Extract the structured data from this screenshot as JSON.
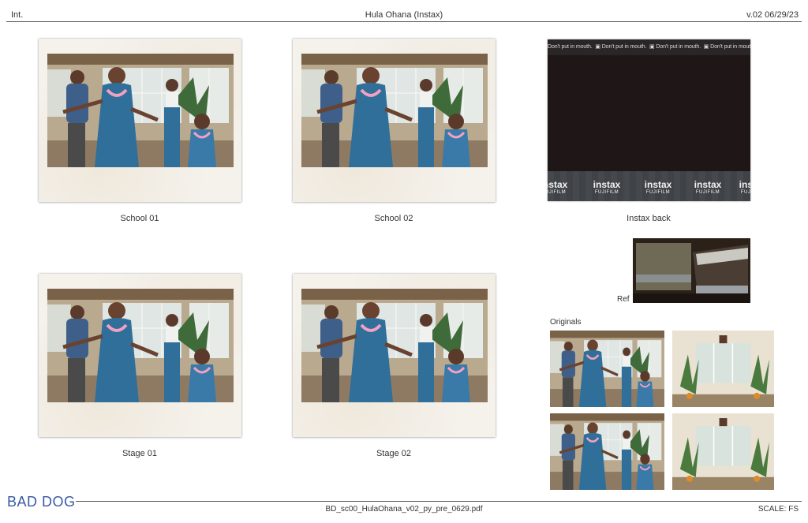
{
  "header": {
    "left": "Int.",
    "title": "Hula Ohana (Instax)",
    "version": "v.02 06/29/23"
  },
  "frames": [
    {
      "caption": "School 01"
    },
    {
      "caption": "School 02"
    },
    {
      "caption": "Stage 01"
    },
    {
      "caption": "Stage 02"
    }
  ],
  "instax_back": {
    "caption": "Instax back",
    "warning_text": "Don't put in mouth.",
    "brand": "instax",
    "maker": "FUJIFILM"
  },
  "ref": {
    "label": "Ref"
  },
  "originals": {
    "label": "Originals"
  },
  "footer": {
    "logo": "BAD DOG",
    "filename": "BD_sc00_HulaOhana_v02_py_pre_0629.pdf",
    "scale": "SCALE: FS"
  },
  "colors": {
    "logo": "#3a5aa6",
    "dress_blue": "#2f6f9a",
    "frame_paper": "#f5f2ec",
    "instax_back": "#1f1618"
  }
}
